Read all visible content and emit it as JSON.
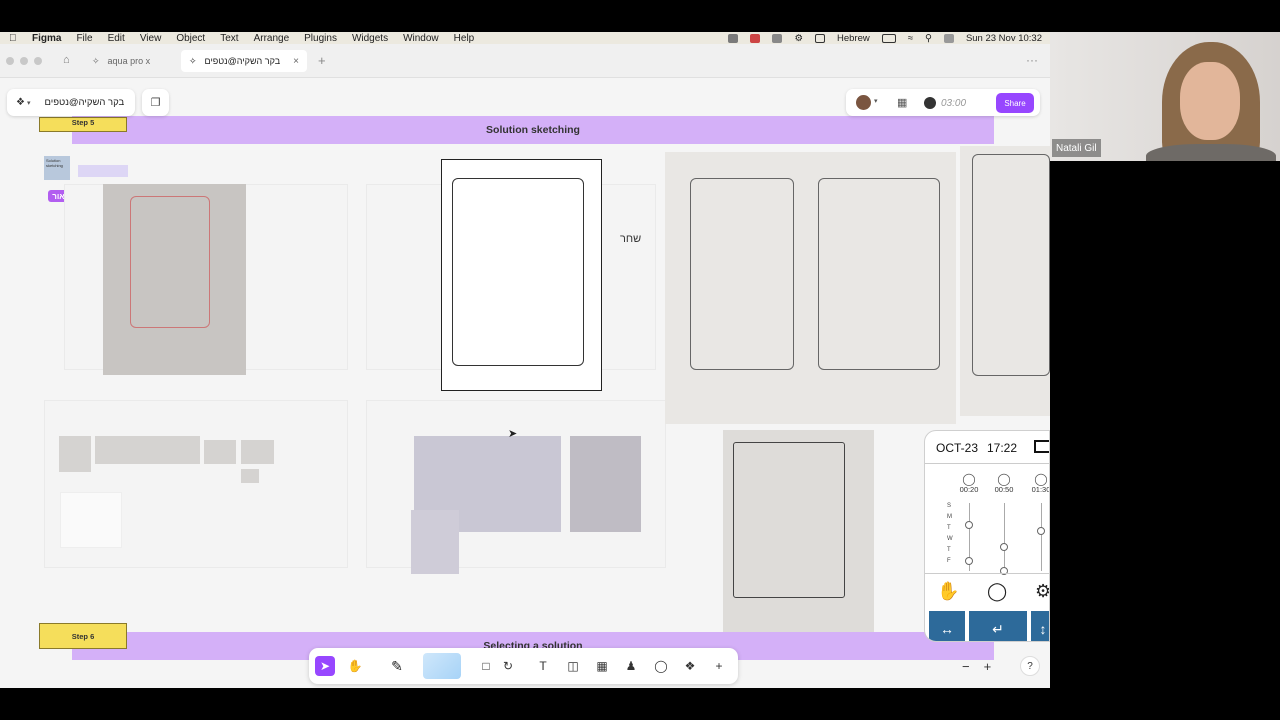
{
  "menubar": {
    "app": "Figma",
    "items": [
      "File",
      "Edit",
      "View",
      "Object",
      "Text",
      "Arrange",
      "Plugins",
      "Widgets",
      "Window",
      "Help"
    ],
    "input_source": "Hebrew",
    "datetime": "Sun 23 Nov  10:32"
  },
  "tabs": {
    "tab1": "aqua pro x",
    "tab2": "בקר השקיה@נטפים"
  },
  "toolbar": {
    "file_name": "בקר השקיה@נטפים",
    "timer": "03:00",
    "share": "Share"
  },
  "board": {
    "step5": "Step 5",
    "section1_title": "Solution sketching",
    "step6": "Step 6",
    "section2_title": "Selecting a solution",
    "note_label": "Solution sketching",
    "tag_label": "ליאור",
    "sticky_label": "שחר",
    "mock": {
      "date": "OCT-23",
      "time": "17:22",
      "col1": "00:20",
      "col2": "00:50",
      "col3": "01:30",
      "days": [
        "S",
        "M",
        "T",
        "W",
        "T",
        "F"
      ]
    }
  },
  "zoom": {
    "minus": "−",
    "plus": "+",
    "help": "?"
  },
  "video": {
    "participant": "Natali Gil"
  },
  "colors": {
    "accent": "#9747ff",
    "section_band": "#d4b0f8",
    "step_tag": "#f5de5b"
  }
}
